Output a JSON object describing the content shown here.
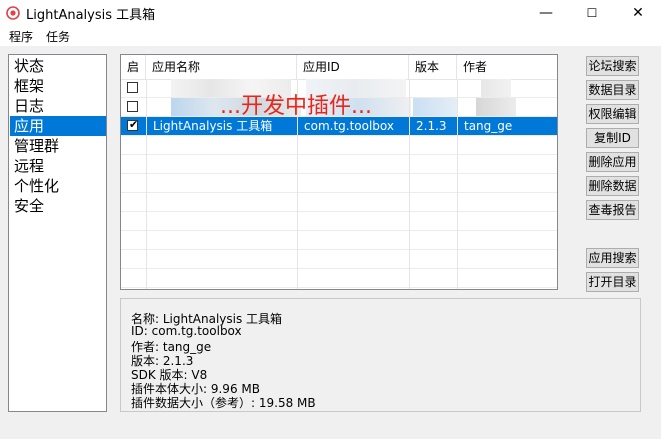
{
  "window": {
    "title": "LightAnalysis 工具箱",
    "minimize": "—",
    "maximize": "☐",
    "close": "✕",
    "accent": "#0078d7"
  },
  "menu": [
    "程序",
    "任务"
  ],
  "nav": {
    "items": [
      "状态",
      "框架",
      "日志",
      "应用",
      "管理群",
      "远程",
      "个性化",
      "安全"
    ],
    "selected": "应用"
  },
  "table": {
    "columns": [
      "启",
      "应用名称",
      "应用ID",
      "版本",
      "作者"
    ],
    "rows": [
      {
        "checked": false,
        "name": "",
        "id": "",
        "version": "",
        "author": "",
        "blurred": true
      },
      {
        "checked": false,
        "name": "",
        "id": "",
        "version": "",
        "author": "",
        "blurred": true
      },
      {
        "checked": true,
        "name": "LightAnalysis 工具箱",
        "id": "com.tg.toolbox",
        "version": "2.1.3",
        "author": "tang_ge",
        "selected": true
      }
    ],
    "overlay_text": "...开发中插件..."
  },
  "buttons": {
    "forum_search": "论坛搜索",
    "data_dir": "数据目录",
    "permission_edit": "权限编辑",
    "copy_id": "复制ID",
    "delete_app": "删除应用",
    "delete_data": "删除数据",
    "virus_report": "查毒报告",
    "app_search": "应用搜索",
    "open_dir": "打开目录"
  },
  "details": [
    "名称:  LightAnalysis 工具箱",
    "ID:  com.tg.toolbox",
    "作者:  tang_ge",
    "版本:  2.1.3",
    "SDK 版本:  V8",
    "插件本体大小:  9.96 MB",
    "插件数据大小（参考）:  19.58 MB"
  ]
}
